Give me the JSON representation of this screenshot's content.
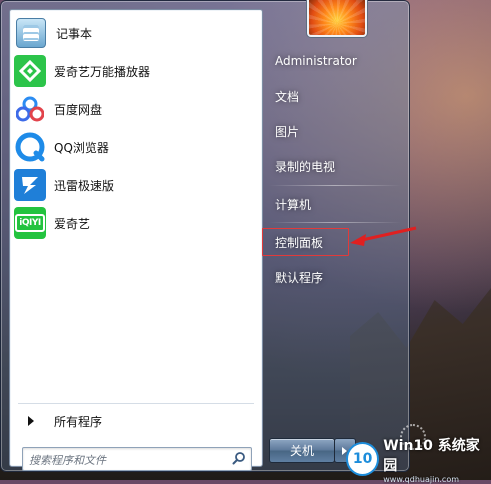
{
  "start_menu": {
    "programs": [
      {
        "label": "记事本",
        "icon": "notepad-icon"
      },
      {
        "label": "爱奇艺万能播放器",
        "icon": "iqiyi-player-icon"
      },
      {
        "label": "百度网盘",
        "icon": "baidu-netdisk-icon"
      },
      {
        "label": "QQ浏览器",
        "icon": "qq-browser-icon"
      },
      {
        "label": "迅雷极速版",
        "icon": "xunlei-icon"
      },
      {
        "label": "爱奇艺",
        "icon": "iqiyi-icon"
      }
    ],
    "all_programs_label": "所有程序",
    "search": {
      "placeholder": "搜索程序和文件"
    },
    "right_items": [
      {
        "label": "Administrator"
      },
      {
        "label": "文档"
      },
      {
        "label": "图片"
      },
      {
        "label": "录制的电视"
      },
      {
        "label": "计算机"
      },
      {
        "label": "控制面板",
        "highlighted": true
      },
      {
        "label": "默认程序"
      }
    ],
    "shutdown_label": "关机"
  },
  "watermark": {
    "logo_text": "10",
    "title": "Win10 系统家园",
    "url": "www.qdhuajin.com"
  },
  "colors": {
    "highlight_border": "#e23a3a",
    "annotation_arrow": "#e02020"
  }
}
